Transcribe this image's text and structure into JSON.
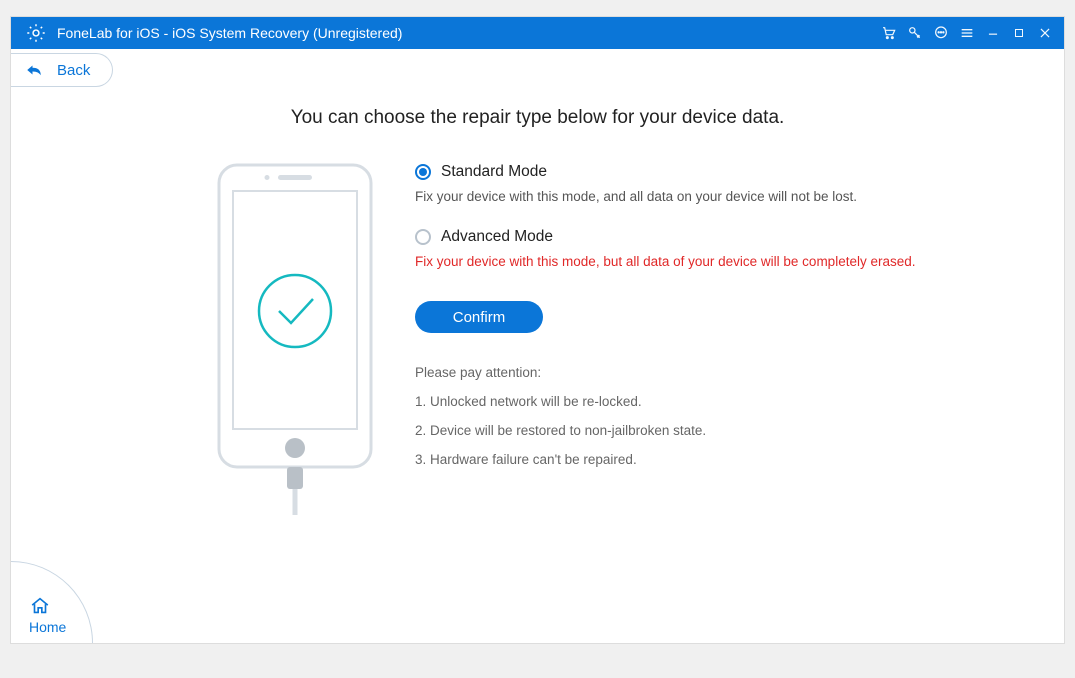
{
  "titlebar": {
    "title": "FoneLab for iOS - iOS System Recovery (Unregistered)"
  },
  "back_label": "Back",
  "heading": "You can choose the repair type below for your device data.",
  "modes": {
    "standard": {
      "label": "Standard Mode",
      "desc": "Fix your device with this mode, and all data on your device will not be lost."
    },
    "advanced": {
      "label": "Advanced Mode",
      "desc": "Fix your device with this mode, but all data of your device will be completely erased."
    }
  },
  "confirm_label": "Confirm",
  "attention": {
    "heading": "Please pay attention:",
    "items": [
      "1. Unlocked network will be re-locked.",
      "2. Device will be restored to non-jailbroken state.",
      "3. Hardware failure can't be repaired."
    ]
  },
  "home_label": "Home"
}
